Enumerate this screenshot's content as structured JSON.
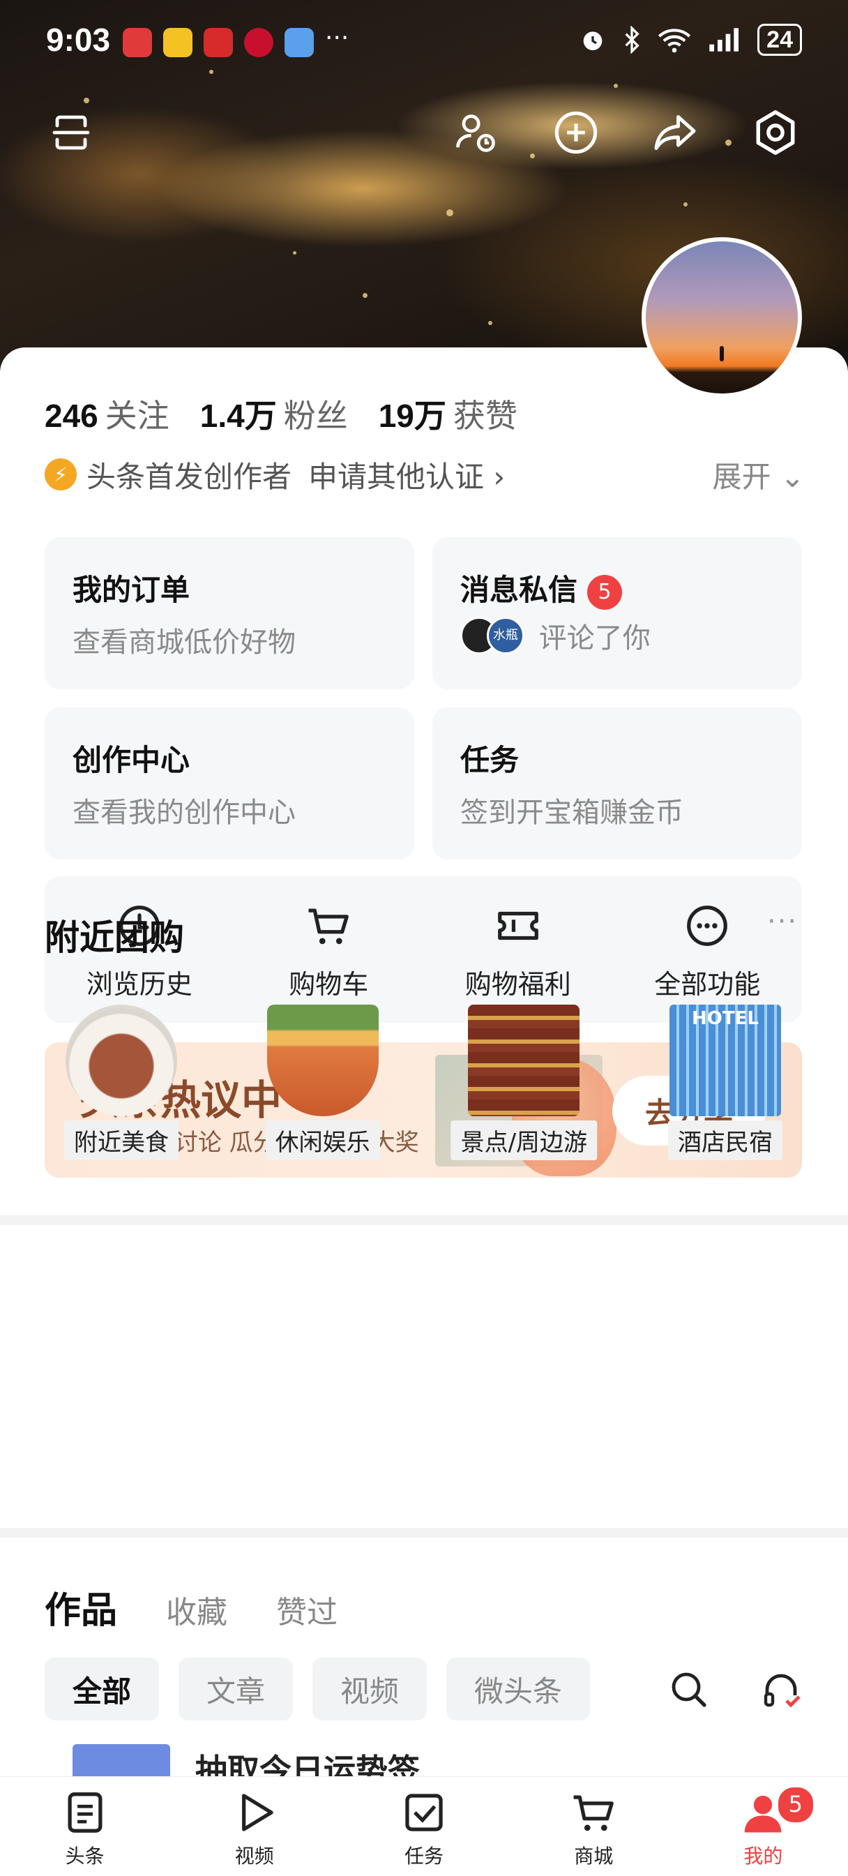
{
  "status_bar": {
    "time": "9:03",
    "battery": "24",
    "more": "···"
  },
  "profile": {
    "stats": [
      {
        "value": "246",
        "label": "关注"
      },
      {
        "value": "1.4万",
        "label": "粉丝"
      },
      {
        "value": "19万",
        "label": "获赞"
      }
    ],
    "certification": "头条首发创作者",
    "apply_certification": "申请其他认证 ›",
    "expand": "展开 ⌄"
  },
  "cards": {
    "orders": {
      "title": "我的订单",
      "subtitle": "查看商城低价好物"
    },
    "messages": {
      "title": "消息私信",
      "badge": "5",
      "subtitle": "评论了你",
      "avatar_text": "水瓶"
    },
    "creator": {
      "title": "创作中心",
      "subtitle": "查看我的创作中心"
    },
    "tasks": {
      "title": "任务",
      "subtitle": "签到开宝箱赚金币"
    }
  },
  "quick_actions": [
    {
      "label": "浏览历史",
      "icon": "clock-icon"
    },
    {
      "label": "购物车",
      "icon": "cart-icon"
    },
    {
      "label": "购物福利",
      "icon": "ticket-icon"
    },
    {
      "label": "全部功能",
      "icon": "more-circle-icon"
    }
  ],
  "banner": {
    "title": "头条热议中",
    "subtitle": "参与热点讨论 瓜分万元现金大奖",
    "button": "去分享"
  },
  "nearby": {
    "title": "附近团购",
    "more": "···",
    "items": [
      {
        "label": "附近美食"
      },
      {
        "label": "休闲娱乐"
      },
      {
        "label": "景点/周边游"
      },
      {
        "label": "酒店民宿",
        "image_text": "HOTEL"
      }
    ]
  },
  "works": {
    "tabs": [
      "作品",
      "收藏",
      "赞过"
    ],
    "filters": [
      "全部",
      "文章",
      "视频",
      "微头条"
    ],
    "peek_title": "抽取今日运势签"
  },
  "bottom_nav": [
    {
      "label": "头条",
      "icon": "article-icon"
    },
    {
      "label": "视频",
      "icon": "play-icon"
    },
    {
      "label": "任务",
      "icon": "task-check-icon"
    },
    {
      "label": "商城",
      "icon": "mall-cart-icon"
    },
    {
      "label": "我的",
      "icon": "profile-icon",
      "badge": "5"
    }
  ],
  "colors": {
    "accent_red": "#f04142",
    "badge_orange": "#f5a623",
    "banner_text": "#8a4a2a"
  }
}
